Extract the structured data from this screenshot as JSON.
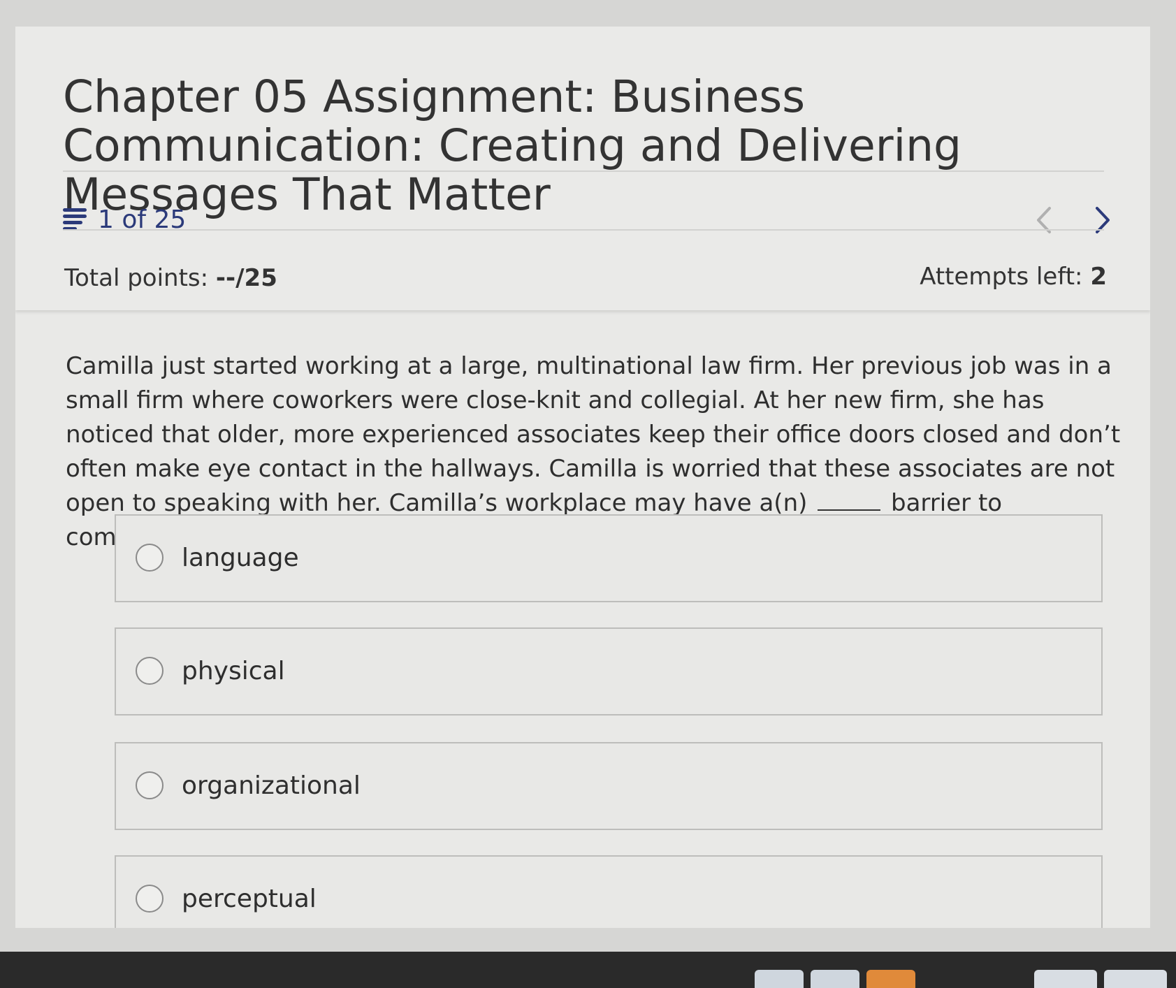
{
  "header": {
    "title": "Chapter 05 Assignment: Business Communication: Creating and Delivering Messages That Matter",
    "counter": "1 of 25",
    "points_label": "Total points: ",
    "points_value": "--/25",
    "attempts_label": "Attempts left: ",
    "attempts_value": "2"
  },
  "question": {
    "text_before": "Camilla just started working at a large, multinational law firm. Her previous job was in a small firm where coworkers were close-knit and collegial. At her new firm, she has noticed that older, more experienced associates keep their office doors closed and don’t often make eye contact in the hallways. Camilla is worried that these associates are not open to speaking with her. Camilla’s workplace may have a(n)",
    "text_after": "barrier to communication."
  },
  "options": [
    {
      "label": "language"
    },
    {
      "label": "physical"
    },
    {
      "label": "organizational"
    },
    {
      "label": "perceptual"
    }
  ],
  "colors": {
    "accent": "#2b3a7a",
    "page_bg": "#e9e9e7",
    "border": "#bdbdbb"
  }
}
